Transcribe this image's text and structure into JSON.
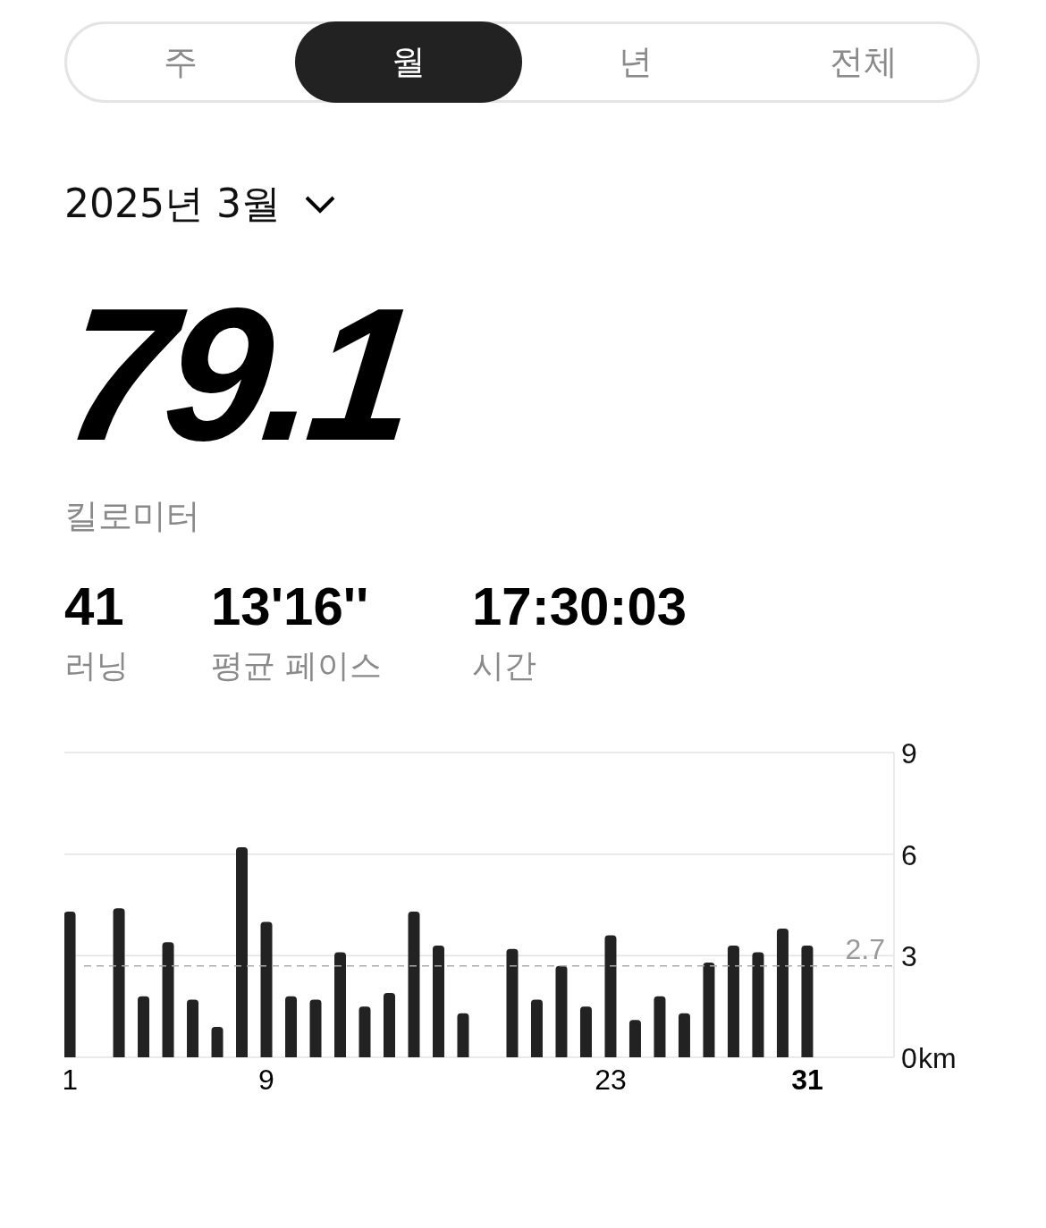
{
  "tabs": [
    {
      "label": "주",
      "selected": false
    },
    {
      "label": "월",
      "selected": true
    },
    {
      "label": "년",
      "selected": false
    },
    {
      "label": "전체",
      "selected": false
    }
  ],
  "period": {
    "label": "2025년 3월"
  },
  "total": {
    "value": "79.1",
    "unit": "킬로미터"
  },
  "stats": [
    {
      "value": "41",
      "label": "러닝"
    },
    {
      "value": "13'16''",
      "label": "평균 페이스"
    },
    {
      "value": "17:30:03",
      "label": "시간"
    }
  ],
  "chart": {
    "chart_data": {
      "type": "bar",
      "ylabel": "km",
      "x": [
        1,
        2,
        3,
        4,
        5,
        6,
        7,
        8,
        9,
        10,
        11,
        12,
        13,
        14,
        15,
        16,
        17,
        18,
        19,
        20,
        21,
        22,
        23,
        24,
        25,
        26,
        27,
        28,
        29,
        30,
        31
      ],
      "values": [
        4.3,
        0,
        4.4,
        1.8,
        3.4,
        1.7,
        0.9,
        6.2,
        4.0,
        1.8,
        1.7,
        3.1,
        1.5,
        1.9,
        4.3,
        3.3,
        1.3,
        0,
        3.2,
        1.7,
        2.7,
        1.5,
        3.6,
        1.1,
        1.8,
        1.3,
        2.8,
        3.3,
        3.1,
        3.8,
        3.3
      ],
      "xlim": [
        0.78,
        34.53
      ],
      "ylim": [
        0,
        9
      ],
      "xticks": [
        {
          "value": 1,
          "label": "1"
        },
        {
          "value": 9,
          "label": "9"
        },
        {
          "value": 23,
          "label": "23"
        },
        {
          "value": 31,
          "label": "31"
        }
      ],
      "yticks": [
        {
          "value": 0,
          "label": "0"
        },
        {
          "value": 3,
          "label": "3"
        },
        {
          "value": 6,
          "label": "6"
        },
        {
          "value": 9,
          "label": "9"
        }
      ]
    },
    "average": {
      "label": "2.7"
    }
  }
}
